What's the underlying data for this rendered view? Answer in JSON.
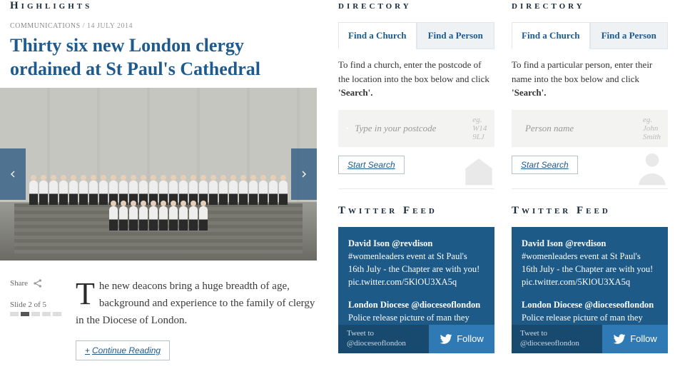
{
  "highlights": {
    "heading": "Highlights",
    "meta_category": "COMMUNICATIONS",
    "meta_sep": " / ",
    "meta_date": "14 JULY 2014",
    "title": "Thirty six new London clergy ordained at St Paul's Cathedral",
    "share_label": "Share",
    "slide_label": "Slide 2 of 5",
    "teaser_first": "T",
    "teaser_rest": "he new deacons bring a huge breadth of age, background and experience to the family of clergy in the Diocese of London.",
    "continue_plus": "+",
    "continue_label": "Continue Reading"
  },
  "directory1": {
    "heading": "directory",
    "tab_church": "Find a Church",
    "tab_person": "Find a Person",
    "text_a": "To find a church, enter the postcode of the location into the box below and click ",
    "text_b": "'Search'.",
    "placeholder": "Type in your postcode",
    "hint": "eg. W14 9LJ",
    "button": "Start Search"
  },
  "directory2": {
    "heading": "directory",
    "tab_church": "Find a Church",
    "tab_person": "Find a Person",
    "text_a": "To find a particular person, enter their name into the box below and click ",
    "text_b": "'Search'.",
    "placeholder": "Person name",
    "hint": "eg. John Smith",
    "button": "Start Search"
  },
  "twitter": {
    "heading": "Twitter Feed",
    "t1_name": "David Ison ",
    "t1_handle": "@revdison",
    "t1_body": "#womenleaders event at St Paul's 16th July - the Chapter are with you! pic.twitter.com/5KlOU3XA5q",
    "t2_name": "London Diocese ",
    "t2_handle": "@dioceseoflondon",
    "t2_body": "Police release picture of man they would like to question about collection tins stolen from churches",
    "tweet_to_a": "Tweet to",
    "tweet_to_b": "@dioceseoflondon",
    "follow": "Follow"
  }
}
